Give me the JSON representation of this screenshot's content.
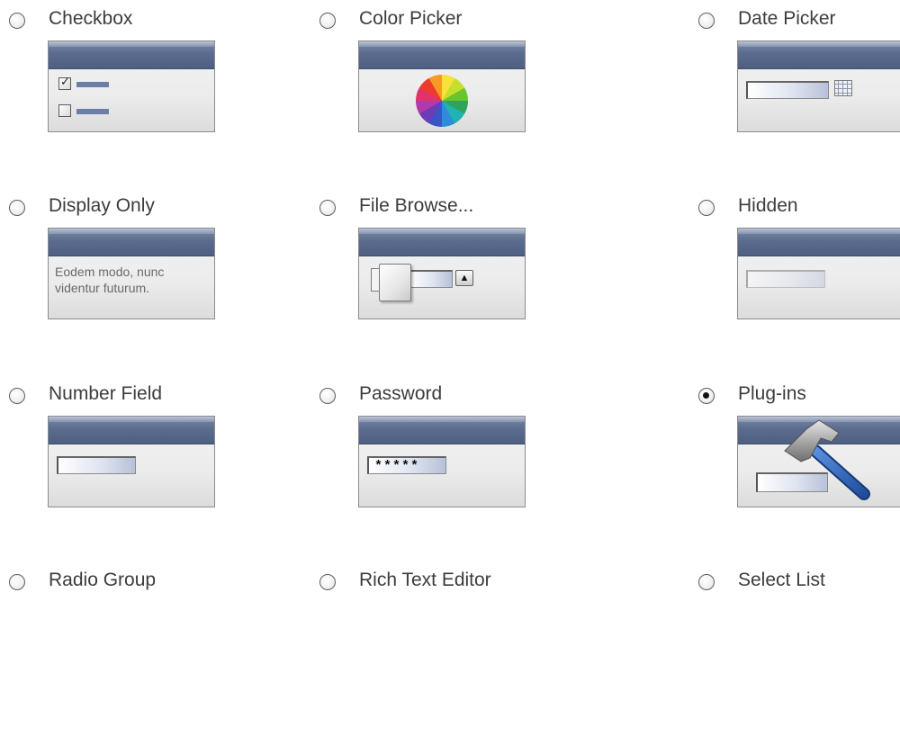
{
  "options": [
    {
      "label": "Checkbox",
      "selected": false
    },
    {
      "label": "Color Picker",
      "selected": false
    },
    {
      "label": "Date Picker",
      "selected": false
    },
    {
      "label": "Display Only",
      "selected": false
    },
    {
      "label": "File Browse...",
      "selected": false
    },
    {
      "label": "Hidden",
      "selected": false
    },
    {
      "label": "Number Field",
      "selected": false
    },
    {
      "label": "Password",
      "selected": false
    },
    {
      "label": "Plug-ins",
      "selected": true
    },
    {
      "label": "Radio Group",
      "selected": false
    },
    {
      "label": "Rich Text Editor",
      "selected": false
    },
    {
      "label": "Select List",
      "selected": false
    }
  ],
  "previews": {
    "display_only_text_line1": "Eodem modo, nunc",
    "display_only_text_line2": "videntur futurum.",
    "password_mask": "*****",
    "browse_button_glyph": "▲"
  },
  "icons": {
    "color_picker": "color-wheel-icon",
    "date_picker": "calendar-icon",
    "file_browse": "folder-icon",
    "plug_ins": "hammer-icon",
    "checkbox_checked": "checkmark-icon"
  },
  "colors": {
    "title_bar": "#5b6c8e",
    "label_text": "#3c3c3c",
    "hammer_handle": "#2f63b8"
  }
}
